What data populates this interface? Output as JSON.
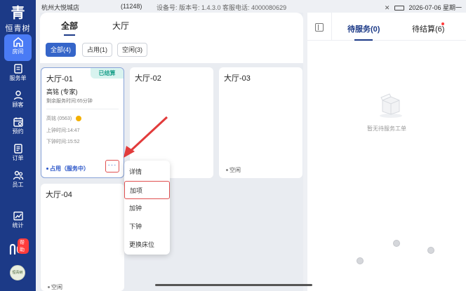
{
  "app": {
    "logo_text": "恒青树",
    "logo_glyph": "青"
  },
  "status_bar": {
    "store": "杭州大悦城店",
    "store_code": "(11248)",
    "device_info": "设备号: 版本号: 1.4.3.0 客服电话: 4000080629",
    "datetime": "2026-07-06 星期一"
  },
  "sidebar": {
    "items": [
      {
        "label": "房间",
        "icon": "house-icon",
        "active": true
      },
      {
        "label": "服务单",
        "icon": "service-order-icon",
        "active": false
      },
      {
        "label": "顾客",
        "icon": "customer-icon",
        "active": false
      },
      {
        "label": "预约",
        "icon": "calendar-icon",
        "active": false
      },
      {
        "label": "订单",
        "icon": "order-icon",
        "active": false
      },
      {
        "label": "员工",
        "icon": "staff-icon",
        "active": false
      },
      {
        "label": "统计",
        "icon": "stats-icon",
        "active": false
      }
    ],
    "help_badge": "帮助",
    "avatar_text": "恒青树"
  },
  "main": {
    "top_tabs": [
      {
        "label": "全部",
        "active": true
      },
      {
        "label": "大厅",
        "active": false
      }
    ],
    "filters": [
      {
        "label": "全部(4)",
        "active": true
      },
      {
        "label": "占用(1)",
        "active": false
      },
      {
        "label": "空闲(3)",
        "active": false
      }
    ],
    "rooms": [
      {
        "name": "大厅-01",
        "tag": "已结算",
        "therapist": "高铭 (专家)",
        "remaining": "剩余服务时间:65分钟",
        "therapist_code": "高铭 (0563)",
        "start_time": "上钟时间:14:47",
        "end_time": "下钟时间:15:52",
        "status": "占用（服务中）",
        "more": "···"
      },
      {
        "name": "大厅-02",
        "status": "空闲"
      },
      {
        "name": "大厅-03",
        "status": "空闲"
      },
      {
        "name": "大厅-04",
        "status": "空闲"
      }
    ]
  },
  "context_menu": {
    "items": [
      "详情",
      "加项",
      "加钟",
      "下钟",
      "更换床位"
    ],
    "highlighted": "加项"
  },
  "right_panel": {
    "tabs": [
      {
        "label": "待服务(0)",
        "active": true
      },
      {
        "label": "待结算(6)",
        "active": false
      }
    ],
    "empty_text": "暂无待服务工单"
  },
  "colors": {
    "sidebar": "#1c3a87",
    "accent": "#3565c9",
    "settled": "#1aa08a",
    "highlight_border": "#e05050",
    "arrow": "#e23b3b"
  }
}
